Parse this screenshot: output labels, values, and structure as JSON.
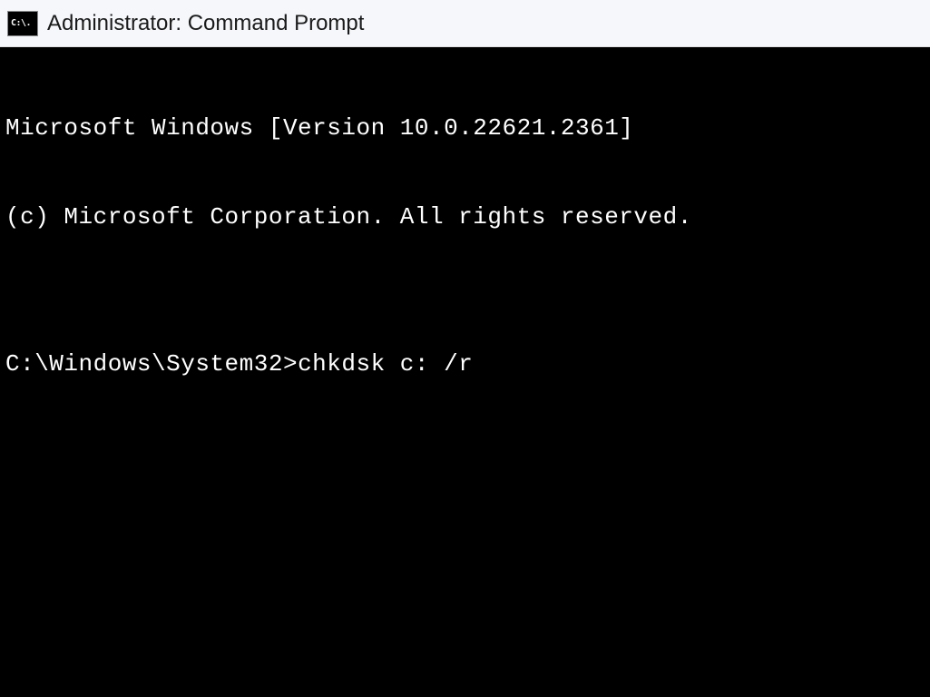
{
  "titlebar": {
    "icon_text": "C:\\.",
    "title": "Administrator: Command Prompt"
  },
  "terminal": {
    "lines": [
      "Microsoft Windows [Version 10.0.22621.2361]",
      "(c) Microsoft Corporation. All rights reserved.",
      ""
    ],
    "prompt_path": "C:\\Windows\\System32>",
    "prompt_command": "chkdsk c: /r"
  }
}
